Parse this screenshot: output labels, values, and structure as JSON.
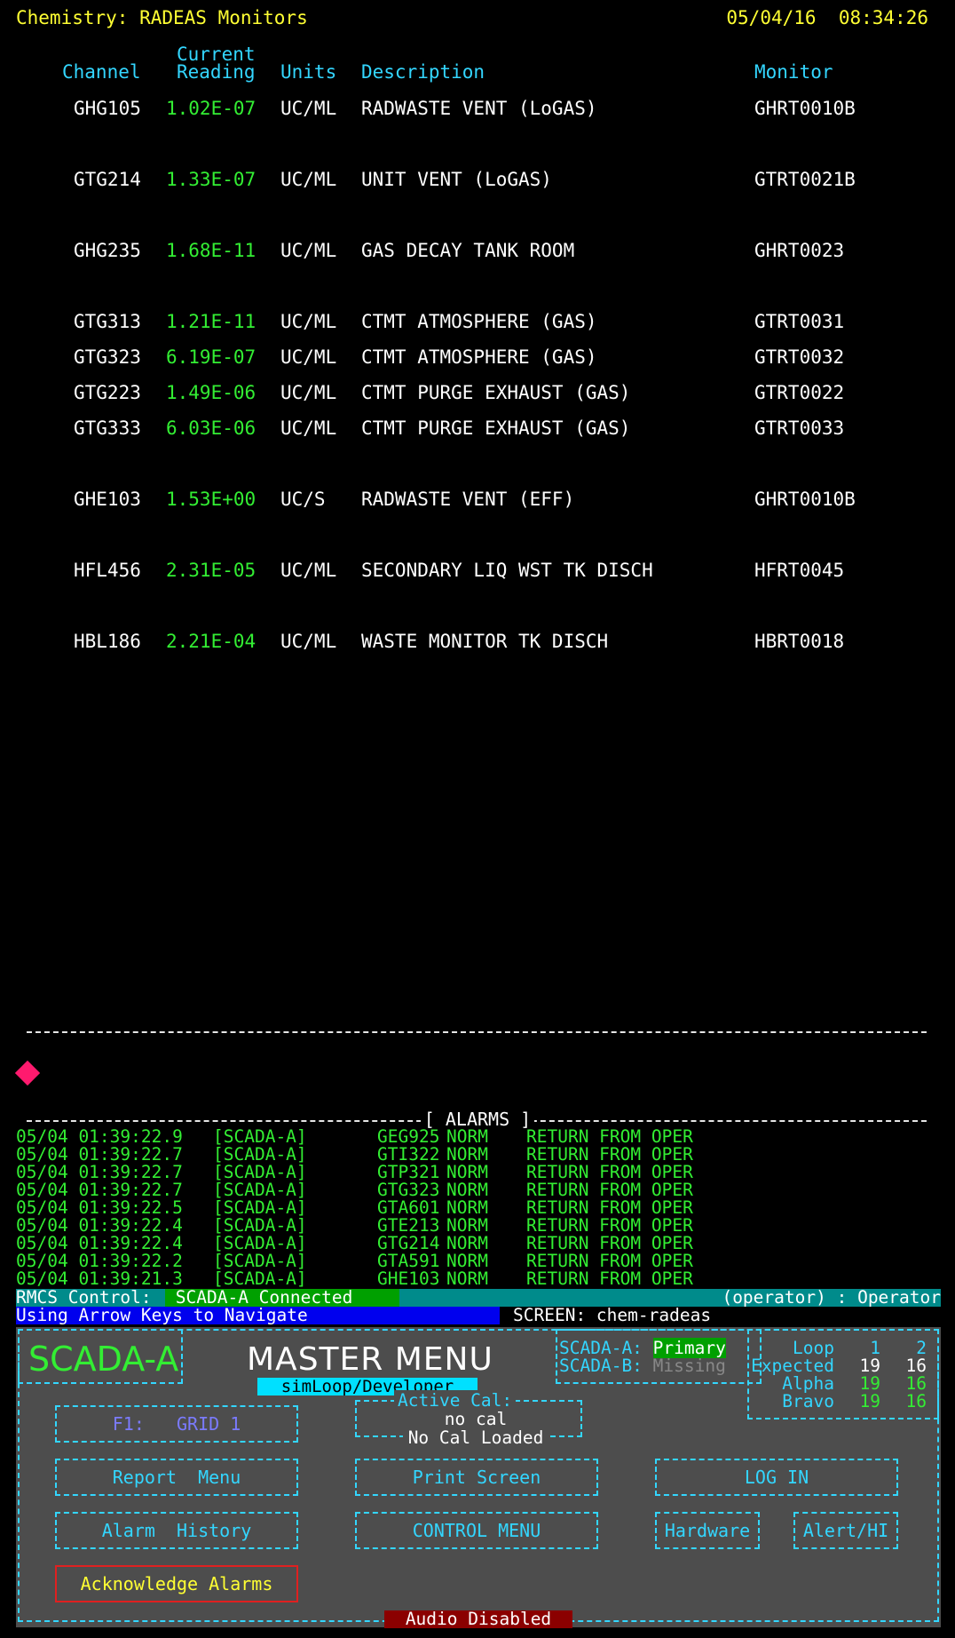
{
  "header": {
    "title": "Chemistry: RADEAS Monitors",
    "date": "05/04/16",
    "time": "08:34:26"
  },
  "columns": {
    "channel": "Channel",
    "reading_top": "Current",
    "reading": "Reading",
    "units": "Units",
    "description": "Description",
    "monitor": "Monitor"
  },
  "rows": [
    {
      "channel": "GHG105",
      "reading": "1.02E-07",
      "units": "UC/ML",
      "description": "RADWASTE VENT (LoGAS)",
      "monitor": "GHRT0010B"
    },
    {
      "channel": "GTG214",
      "reading": "1.33E-07",
      "units": "UC/ML",
      "description": "UNIT VENT (LoGAS)",
      "monitor": "GTRT0021B"
    },
    {
      "channel": "GHG235",
      "reading": "1.68E-11",
      "units": "UC/ML",
      "description": "GAS DECAY TANK ROOM",
      "monitor": "GHRT0023"
    },
    {
      "channel": "GTG313",
      "reading": "1.21E-11",
      "units": "UC/ML",
      "description": "CTMT ATMOSPHERE (GAS)",
      "monitor": "GTRT0031"
    },
    {
      "channel": "GTG323",
      "reading": "6.19E-07",
      "units": "UC/ML",
      "description": "CTMT ATMOSPHERE (GAS)",
      "monitor": "GTRT0032"
    },
    {
      "channel": "GTG223",
      "reading": "1.49E-06",
      "units": "UC/ML",
      "description": "CTMT PURGE EXHAUST (GAS)",
      "monitor": "GTRT0022"
    },
    {
      "channel": "GTG333",
      "reading": "6.03E-06",
      "units": "UC/ML",
      "description": "CTMT PURGE EXHAUST (GAS)",
      "monitor": "GTRT0033"
    },
    {
      "channel": "GHE103",
      "reading": "1.53E+00",
      "units": "UC/S",
      "description": "RADWASTE VENT (EFF)",
      "monitor": "GHRT0010B"
    },
    {
      "channel": "HFL456",
      "reading": "2.31E-05",
      "units": "UC/ML",
      "description": "SECONDARY LIQ WST TK DISCH",
      "monitor": "HFRT0045"
    },
    {
      "channel": "HBL186",
      "reading": "2.21E-04",
      "units": "UC/ML",
      "description": "WASTE MONITOR TK DISCH",
      "monitor": "HBRT0018"
    }
  ],
  "alarms": {
    "title": "[ ALARMS ]",
    "entries": [
      {
        "datetime": "05/04 01:39:22.9",
        "source": "[SCADA-A]",
        "tag": "GEG925",
        "state": "NORM",
        "message": "RETURN FROM OPER"
      },
      {
        "datetime": "05/04 01:39:22.7",
        "source": "[SCADA-A]",
        "tag": "GTI322",
        "state": "NORM",
        "message": "RETURN FROM OPER"
      },
      {
        "datetime": "05/04 01:39:22.7",
        "source": "[SCADA-A]",
        "tag": "GTP321",
        "state": "NORM",
        "message": "RETURN FROM OPER"
      },
      {
        "datetime": "05/04 01:39:22.7",
        "source": "[SCADA-A]",
        "tag": "GTG323",
        "state": "NORM",
        "message": "RETURN FROM OPER"
      },
      {
        "datetime": "05/04 01:39:22.5",
        "source": "[SCADA-A]",
        "tag": "GTA601",
        "state": "NORM",
        "message": "RETURN FROM OPER"
      },
      {
        "datetime": "05/04 01:39:22.4",
        "source": "[SCADA-A]",
        "tag": "GTE213",
        "state": "NORM",
        "message": "RETURN FROM OPER"
      },
      {
        "datetime": "05/04 01:39:22.4",
        "source": "[SCADA-A]",
        "tag": "GTG214",
        "state": "NORM",
        "message": "RETURN FROM OPER"
      },
      {
        "datetime": "05/04 01:39:22.2",
        "source": "[SCADA-A]",
        "tag": "GTA591",
        "state": "NORM",
        "message": "RETURN FROM OPER"
      },
      {
        "datetime": "05/04 01:39:21.3",
        "source": "[SCADA-A]",
        "tag": "GHE103",
        "state": "NORM",
        "message": "RETURN FROM OPER"
      }
    ]
  },
  "status": {
    "rmcs_label": "RMCS Control:",
    "connection": "SCADA-A Connected",
    "operator": "(operator) : Operator",
    "navigation": "Using Arrow Keys to Navigate",
    "screen": "SCREEN: chem-radeas"
  },
  "menu": {
    "system": "SCADA-A",
    "title": "MASTER MENU",
    "mode": "simLoop/Developer",
    "scada_a_label": "SCADA-A:",
    "scada_a_value": "Primary",
    "scada_b_label": "SCADA-B:",
    "scada_b_value": "Missing",
    "loop": {
      "label": "Loop",
      "col1": "1",
      "col2": "2",
      "expected_label": "Expected",
      "expected_1": "19",
      "expected_2": "16",
      "alpha_label": "Alpha",
      "alpha_1": "19",
      "alpha_2": "16",
      "bravo_label": "Bravo",
      "bravo_1": "19",
      "bravo_2": "16"
    },
    "active_cal_label": "Active Cal:",
    "cal_value": "no cal",
    "cal_status": "No Cal Loaded",
    "buttons": {
      "f1": "F1:   GRID 1",
      "report": "Report  Menu",
      "print": "Print Screen",
      "login": "LOG IN",
      "alarm_history": "Alarm  History",
      "control": "CONTROL MENU",
      "hardware": "Hardware",
      "alert": "Alert/HI",
      "ack": "Acknowledge Alarms"
    },
    "audio": "Audio Disabled"
  },
  "colors": {
    "background": "#000000",
    "header_text": "#ffff33",
    "column_header": "#33d6ff",
    "reading_green": "#33ee33",
    "alert_diamond": "#ff1a6e",
    "panel_bg": "#4d4d4d"
  }
}
